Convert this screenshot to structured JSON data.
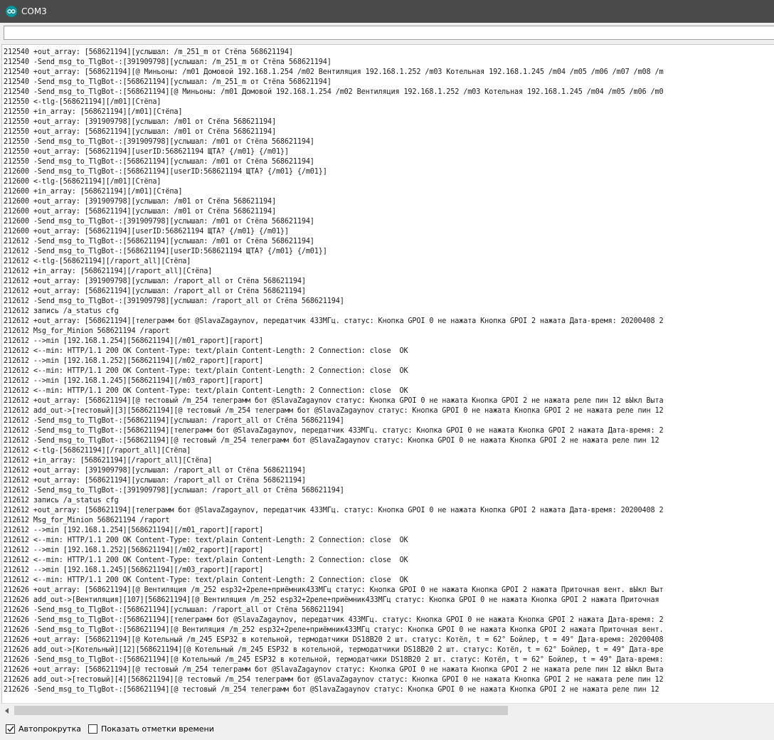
{
  "window": {
    "title": "COM3"
  },
  "send_field": {
    "value": ""
  },
  "log_lines": [
    "212540 +out_array: [568621194][услышал: /m_251_m от Стёпа 568621194]",
    "212540 -Send_msg_to_TlgBot-:[391909798][услышал: /m_251_m от Стёпа 568621194]",
    "212540 +out_array: [568621194][@ Миньоны: /m01 Домовой 192.168.1.254 /m02 Вентиляция 192.168.1.252 /m03 Котельная 192.168.1.245 /m04 /m05 /m06 /m07 /m08 /m",
    "212540 -Send_msg_to_TlgBot-:[568621194][услышал: /m_251_m от Стёпа 568621194]",
    "212540 -Send_msg_to_TlgBot-:[568621194][@ Миньоны: /m01 Домовой 192.168.1.254 /m02 Вентиляция 192.168.1.252 /m03 Котельная 192.168.1.245 /m04 /m05 /m06 /m0",
    "212550 <-tlg-[568621194][/m01][Стёпа]",
    "212550 +in_array: [568621194][/m01][Стёпа]",
    "212550 +out_array: [391909798][услышал: /m01 от Стёпа 568621194]",
    "212550 +out_array: [568621194][услышал: /m01 от Стёпа 568621194]",
    "212550 -Send_msg_to_TlgBot-:[391909798][услышал: /m01 от Стёпа 568621194]",
    "212550 +out_array: [568621194][userID:568621194 ЩТА? {/m01} {/m01}]",
    "212550 -Send_msg_to_TlgBot-:[568621194][услышал: /m01 от Стёпа 568621194]",
    "212600 -Send_msg_to_TlgBot-:[568621194][userID:568621194 ЩТА? {/m01} {/m01}]",
    "212600 <-tlg-[568621194][/m01][Стёпа]",
    "212600 +in_array: [568621194][/m01][Стёпа]",
    "212600 +out_array: [391909798][услышал: /m01 от Стёпа 568621194]",
    "212600 +out_array: [568621194][услышал: /m01 от Стёпа 568621194]",
    "212600 -Send_msg_to_TlgBot-:[391909798][услышал: /m01 от Стёпа 568621194]",
    "212600 +out_array: [568621194][userID:568621194 ЩТА? {/m01} {/m01}]",
    "212612 -Send_msg_to_TlgBot-:[568621194][услышал: /m01 от Стёпа 568621194]",
    "212612 -Send_msg_to_TlgBot-:[568621194][userID:568621194 ЩТА? {/m01} {/m01}]",
    "212612 <-tlg-[568621194][/raport_all][Стёпа]",
    "212612 +in_array: [568621194][/raport_all][Стёпа]",
    "212612 +out_array: [391909798][услышал: /raport_all от Стёпа 568621194]",
    "212612 +out_array: [568621194][услышал: /raport_all от Стёпа 568621194]",
    "212612 -Send_msg_to_TlgBot-:[391909798][услышал: /raport_all от Стёпа 568621194]",
    "212612 запись /a_status cfg",
    "212612 +out_array: [568621194][телеграмм бот @SlavaZagaynov, передатчик 433МГц. статус: Кнопка GPOI 0 не нажата Кнопка GPOI 2 нажата Дата-время: 20200408 2",
    "212612 Msg_for_Minion 568621194 /raport",
    "212612 -->min [192.168.1.254][568621194][/m01_raport][raport]",
    "212612 <--min: HTTP/1.1 200 OK Content-Type: text/plain Content-Length: 2 Connection: close  OK",
    "212612 -->min [192.168.1.252][568621194][/m02_raport][raport]",
    "212612 <--min: HTTP/1.1 200 OK Content-Type: text/plain Content-Length: 2 Connection: close  OK",
    "212612 -->min [192.168.1.245][568621194][/m03_raport][raport]",
    "212612 <--min: HTTP/1.1 200 OK Content-Type: text/plain Content-Length: 2 Connection: close  OK",
    "212612 +out_array: [568621194][@ тестовый /m_254 телеграмм бот @SlavaZagaynov статус: Кнопка GPOI 0 не нажата Кнопка GPOI 2 не нажата реле пин 12 вЫкл Выта",
    "212612 add_out->[тестовый][3][568621194][@ тестовый /m_254 телеграмм бот @SlavaZagaynov статус: Кнопка GPOI 0 не нажата Кнопка GPOI 2 не нажата реле пин 12",
    "212612 -Send_msg_to_TlgBot-:[568621194][услышал: /raport_all от Стёпа 568621194]",
    "212612 -Send_msg_to_TlgBot-:[568621194][телеграмм бот @SlavaZagaynov, передатчик 433МГц. статус: Кнопка GPOI 0 не нажата Кнопка GPOI 2 нажата Дата-время: 2",
    "212612 -Send_msg_to_TlgBot-:[568621194][@ тестовый /m_254 телеграмм бот @SlavaZagaynov статус: Кнопка GPOI 0 не нажата Кнопка GPOI 2 не нажата реле пин 12",
    "212612 <-tlg-[568621194][/raport_all][Стёпа]",
    "212612 +in_array: [568621194][/raport_all][Стёпа]",
    "212612 +out_array: [391909798][услышал: /raport_all от Стёпа 568621194]",
    "212612 +out_array: [568621194][услышал: /raport_all от Стёпа 568621194]",
    "212612 -Send_msg_to_TlgBot-:[391909798][услышал: /raport_all от Стёпа 568621194]",
    "212612 запись /a_status cfg",
    "212612 +out_array: [568621194][телеграмм бот @SlavaZagaynov, передатчик 433МГц. статус: Кнопка GPOI 0 не нажата Кнопка GPOI 2 нажата Дата-время: 20200408 2",
    "212612 Msg_for_Minion 568621194 /raport",
    "212612 -->min [192.168.1.254][568621194][/m01_raport][raport]",
    "212612 <--min: HTTP/1.1 200 OK Content-Type: text/plain Content-Length: 2 Connection: close  OK",
    "212612 -->min [192.168.1.252][568621194][/m02_raport][raport]",
    "212612 <--min: HTTP/1.1 200 OK Content-Type: text/plain Content-Length: 2 Connection: close  OK",
    "212612 -->min [192.168.1.245][568621194][/m03_raport][raport]",
    "212612 <--min: HTTP/1.1 200 OK Content-Type: text/plain Content-Length: 2 Connection: close  OK",
    "212626 +out_array: [568621194][@ Вентиляция /m_252 esp32+2реле+приёмник433МГц статус: Кнопка GPOI 0 не нажата Кнопка GPOI 2 нажата Приточная вент. вЫкл Выт",
    "212626 add_out->[Вентиляция][107][568621194][@ Вентиляция /m_252 esp32+2реле+приёмник433МГц статус: Кнопка GPOI 0 не нажата Кнопка GPOI 2 нажата Приточная",
    "212626 -Send_msg_to_TlgBot-:[568621194][услышал: /raport_all от Стёпа 568621194]",
    "212626 -Send_msg_to_TlgBot-:[568621194][телеграмм бот @SlavaZagaynov, передатчик 433МГц. статус: Кнопка GPOI 0 не нажата Кнопка GPOI 2 нажата Дата-время: 2",
    "212626 -Send_msg_to_TlgBot-:[568621194][@ Вентиляция /m_252 esp32+2реле+приёмник433МГц статус: Кнопка GPOI 0 не нажата Кнопка GPOI 2 нажата Приточная вент.",
    "212626 +out_array: [568621194][@ Котельный /m_245 ESP32 в котельной, термодатчики DS18B20 2 шт. статус: Котёл, t = 62° Бойлер, t = 49° Дата-время: 20200408",
    "212626 add_out->[Котельный][12][568621194][@ Котельный /m_245 ESP32 в котельной, термодатчики DS18B20 2 шт. статус: Котёл, t = 62° Бойлер, t = 49° Дата-вре",
    "212626 -Send_msg_to_TlgBot-:[568621194][@ Котельный /m_245 ESP32 в котельной, термодатчики DS18B20 2 шт. статус: Котёл, t = 62° Бойлер, t = 49° Дата-время:",
    "212626 +out_array: [568621194][@ тестовый /m_254 телеграмм бот @SlavaZagaynov статус: Кнопка GPOI 0 не нажата Кнопка GPOI 2 не нажата реле пин 12 вЫкл Выта",
    "212626 add_out->[тестовый][4][568621194][@ тестовый /m_254 телеграмм бот @SlavaZagaynov статус: Кнопка GPOI 0 не нажата Кнопка GPOI 2 не нажата реле пин 12",
    "212626 -Send_msg_to_TlgBot-:[568621194][@ тестовый /m_254 телеграмм бот @SlavaZagaynov статус: Кнопка GPOI 0 не нажата Кнопка GPOI 2 не нажата реле пин 12"
  ],
  "footer": {
    "autoscroll": {
      "label": "Автопрокрутка",
      "checked": true
    },
    "timestamps": {
      "label": "Показать отметки времени",
      "checked": false
    }
  },
  "colors": {
    "titlebar": "#4a4a4a",
    "app_icon": "#00979c",
    "console_bg": "#ffffff"
  },
  "icons": {
    "app": "arduino-infinity-icon",
    "checkmark": "checkmark-icon",
    "scroll_left": "arrow-left-icon"
  }
}
